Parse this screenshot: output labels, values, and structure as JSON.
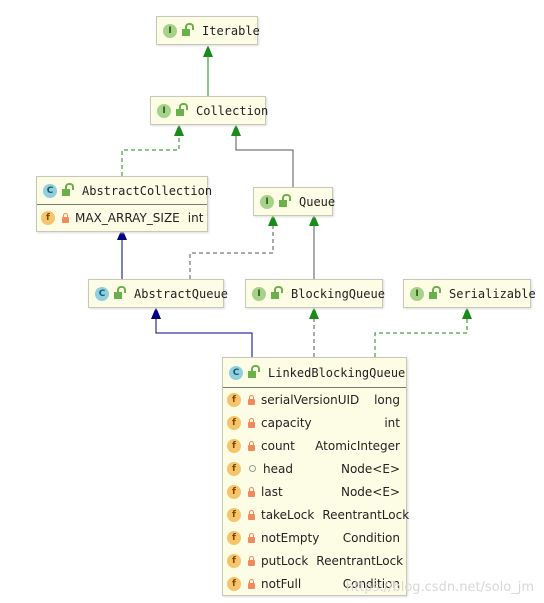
{
  "colors": {
    "implements": "#1a8a1a",
    "extends_class": "#000080",
    "extends_interface": "#555555",
    "node_bg": "#fdfde6"
  },
  "nodes": {
    "iterable": {
      "kind": "I",
      "name": "Iterable"
    },
    "collection": {
      "kind": "I",
      "name": "Collection"
    },
    "abstract_collection": {
      "kind": "C",
      "name": "AbstractCollection",
      "fields": [
        {
          "name": "MAX_ARRAY_SIZE",
          "type": "int",
          "icon": "f"
        }
      ]
    },
    "queue": {
      "kind": "I",
      "name": "Queue"
    },
    "abstract_queue": {
      "kind": "C",
      "name": "AbstractQueue"
    },
    "blocking_queue": {
      "kind": "I",
      "name": "BlockingQueue"
    },
    "serializable": {
      "kind": "I",
      "name": "Serializable"
    },
    "linked_blocking_queue": {
      "kind": "C",
      "name": "LinkedBlockingQueue",
      "fields": [
        {
          "name": "serialVersionUID",
          "type": "long",
          "icon": "f"
        },
        {
          "name": "capacity",
          "type": "int",
          "icon": "f"
        },
        {
          "name": "count",
          "type": "AtomicInteger",
          "icon": "f"
        },
        {
          "name": "head",
          "type": "Node<E>",
          "icon": "f"
        },
        {
          "name": "last",
          "type": "Node<E>",
          "icon": "f"
        },
        {
          "name": "takeLock",
          "type": "ReentrantLock",
          "icon": "f"
        },
        {
          "name": "notEmpty",
          "type": "Condition",
          "icon": "f"
        },
        {
          "name": "putLock",
          "type": "ReentrantLock",
          "icon": "f"
        },
        {
          "name": "notFull",
          "type": "Condition",
          "icon": "f"
        }
      ]
    }
  },
  "watermark": "https://blog.csdn.net/solo_jm"
}
